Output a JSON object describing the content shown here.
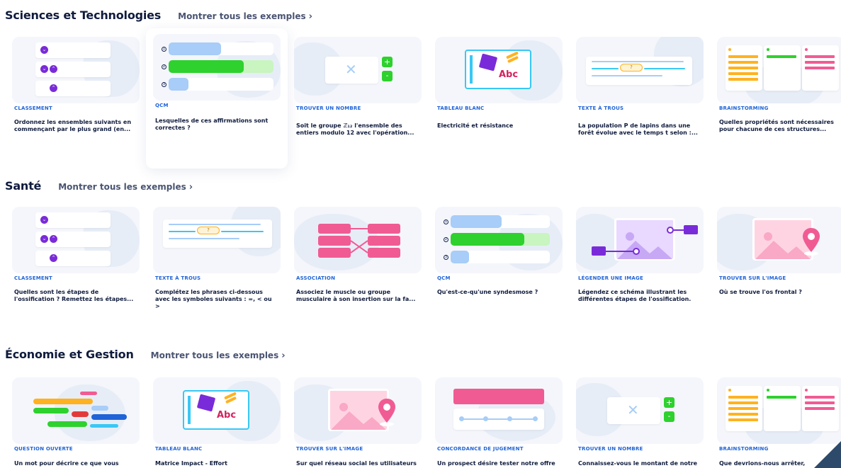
{
  "sections": [
    {
      "title": "Sciences et Technologies",
      "link": "Montrer tous les exemples",
      "cards": [
        {
          "type": "CLASSEMENT",
          "title": "Ordonnez les ensembles suivants en commençant par le plus grand (en..."
        },
        {
          "type": "QCM",
          "title": "Lesquelles de ces affirmations sont correctes ?"
        },
        {
          "type": "TROUVER UN NOMBRE",
          "title": "Soit le groupe ℤ₁₂ l'ensemble des entiers modulo 12 avec l'opération..."
        },
        {
          "type": "TABLEAU BLANC",
          "title": "Electricité et résistance"
        },
        {
          "type": "TEXTE À TROUS",
          "title": "La population P de lapins dans une forêt évolue avec le temps t selon :..."
        },
        {
          "type": "BRAINSTORMING",
          "title": "Quelles propriétés sont nécessaires pour chacune de ces structures..."
        }
      ]
    },
    {
      "title": "Santé",
      "link": "Montrer tous les exemples",
      "cards": [
        {
          "type": "CLASSEMENT",
          "title": "Quelles sont les étapes de l'ossification ? Remettez les étapes..."
        },
        {
          "type": "TEXTE À TROUS",
          "title": "Complétez les phrases ci-dessous avec les symboles suivants : =, < ou >"
        },
        {
          "type": "ASSOCIATION",
          "title": "Associez le muscle ou groupe musculaire à son insertion sur la fa..."
        },
        {
          "type": "QCM",
          "title": "Qu'est-ce-qu'une syndesmose ?"
        },
        {
          "type": "LÉGENDER UNE IMAGE",
          "title": "Légendez ce schéma illustrant les différentes étapes de l'ossification."
        },
        {
          "type": "TROUVER SUR L'IMAGE",
          "title": "Où se trouve l'os frontal ?"
        }
      ]
    },
    {
      "title": "Économie et Gestion",
      "link": "Montrer tous les exemples",
      "cards": [
        {
          "type": "QUESTION OUVERTE",
          "title": "Un mot pour décrire ce que vous"
        },
        {
          "type": "TABLEAU BLANC",
          "title": "Matrice Impact - Effort"
        },
        {
          "type": "TROUVER SUR L'IMAGE",
          "title": "Sur quel réseau social les utilisateurs"
        },
        {
          "type": "CONCORDANCE DE JUGEMENT",
          "title": "Un prospect désire tester notre offre"
        },
        {
          "type": "TROUVER UN NOMBRE",
          "title": "Connaissez-vous le montant de notre"
        },
        {
          "type": "BRAINSTORMING",
          "title": "Que devrions-nous arrêter,"
        }
      ]
    }
  ],
  "thumb_text": {
    "abc": "Abc",
    "question_mark": "?",
    "q_numbers": [
      "1",
      "2",
      "3"
    ],
    "plus": "+",
    "minus": "-",
    "x_mark": "✕"
  },
  "icons": {
    "chevron": "chevron-right-icon",
    "chevron_glyph": "›"
  },
  "colors": {
    "purple": "#7a2bd9",
    "blue_light": "#a7cdf8",
    "green": "#2ed12e",
    "pink": "#f15b93",
    "orange": "#ffb21f",
    "cyan": "#38c8f5",
    "heading": "#0f1b3d",
    "type_label": "#1f63d8"
  }
}
